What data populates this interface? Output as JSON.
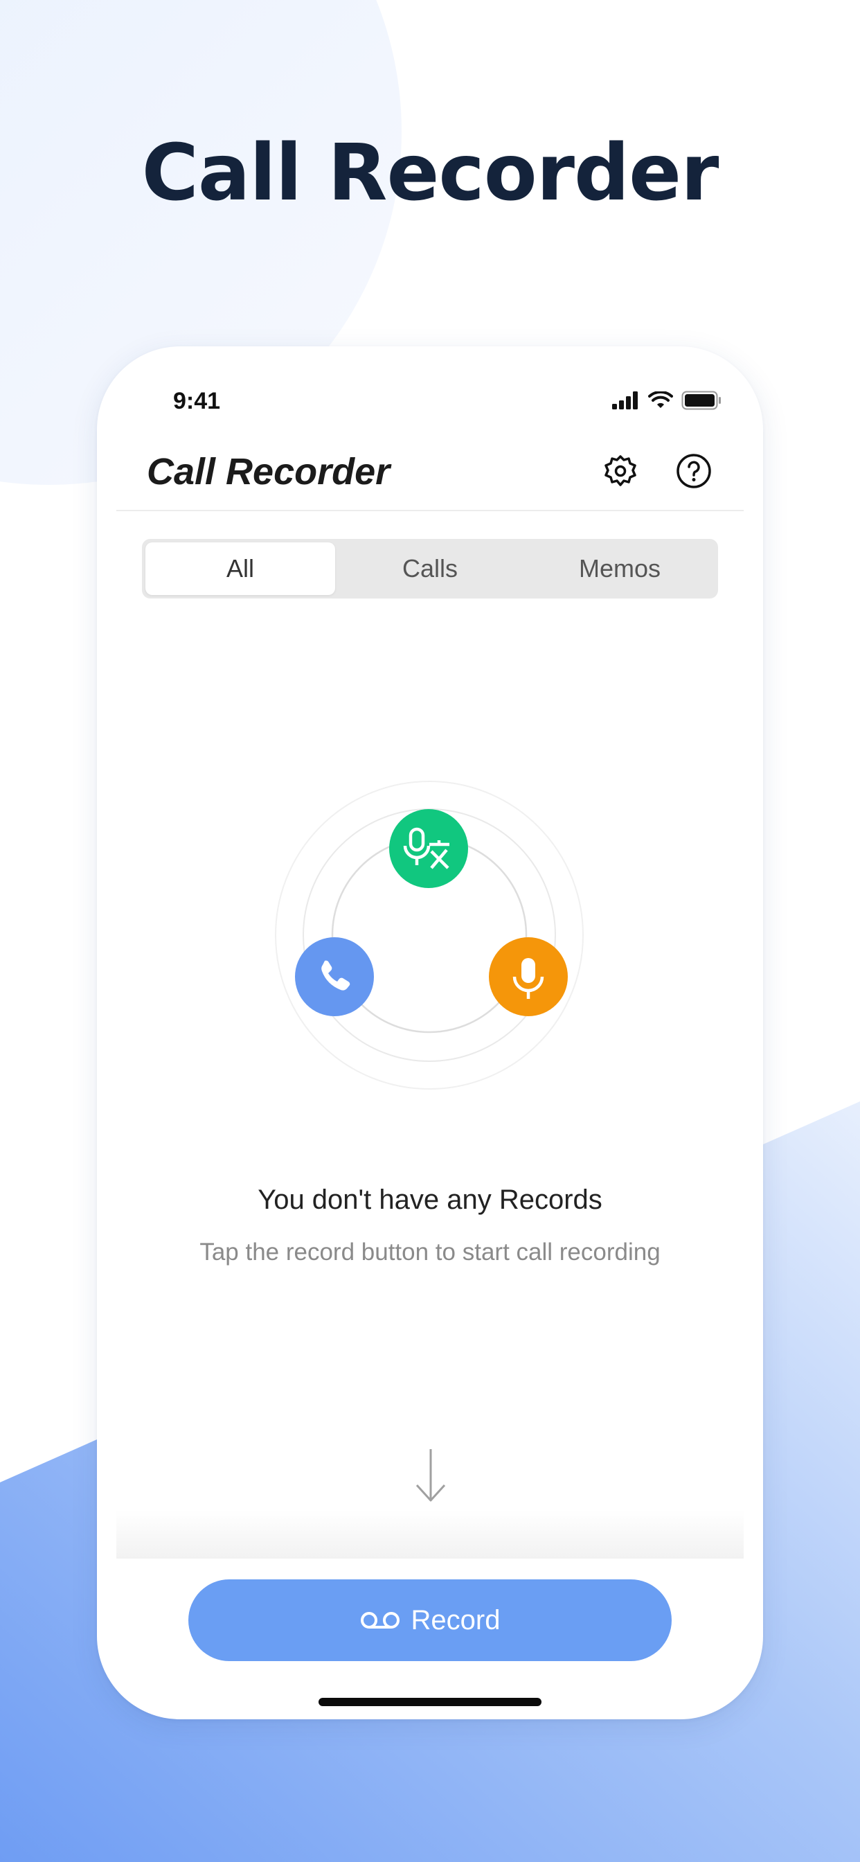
{
  "page": {
    "title": "Call Recorder"
  },
  "status_bar": {
    "time": "9:41"
  },
  "app": {
    "title": "Call Recorder",
    "settings_icon": "gear-icon",
    "help_icon": "question-icon"
  },
  "tabs": [
    {
      "label": "All",
      "selected": true
    },
    {
      "label": "Calls",
      "selected": false
    },
    {
      "label": "Memos",
      "selected": false
    }
  ],
  "illustration": {
    "top_icon": "voice-translate-icon",
    "left_icon": "phone-icon",
    "right_icon": "microphone-icon",
    "colors": {
      "top": "#11c77f",
      "left": "#6597f0",
      "right": "#f5960a"
    }
  },
  "empty_state": {
    "title": "You don't have any Records",
    "subtitle": "Tap the record button to start call recording"
  },
  "record_button": {
    "label": "Record",
    "icon": "voicemail-icon",
    "color": "#6a9ef3"
  },
  "colors": {
    "accent": "#6a9ef3",
    "title": "#14233b"
  }
}
